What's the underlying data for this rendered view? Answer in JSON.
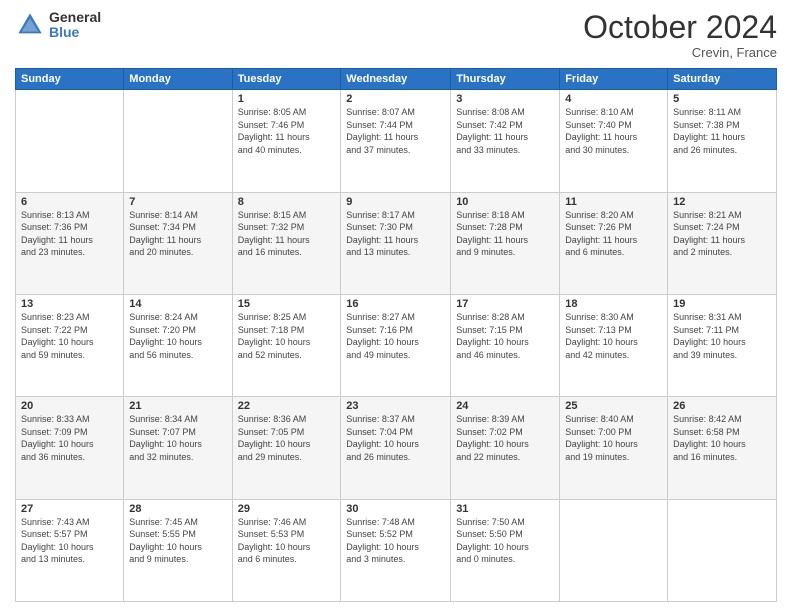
{
  "header": {
    "logo_general": "General",
    "logo_blue": "Blue",
    "month_title": "October 2024",
    "subtitle": "Crevin, France"
  },
  "weekdays": [
    "Sunday",
    "Monday",
    "Tuesday",
    "Wednesday",
    "Thursday",
    "Friday",
    "Saturday"
  ],
  "weeks": [
    [
      {
        "day": "",
        "info": ""
      },
      {
        "day": "",
        "info": ""
      },
      {
        "day": "1",
        "info": "Sunrise: 8:05 AM\nSunset: 7:46 PM\nDaylight: 11 hours\nand 40 minutes."
      },
      {
        "day": "2",
        "info": "Sunrise: 8:07 AM\nSunset: 7:44 PM\nDaylight: 11 hours\nand 37 minutes."
      },
      {
        "day": "3",
        "info": "Sunrise: 8:08 AM\nSunset: 7:42 PM\nDaylight: 11 hours\nand 33 minutes."
      },
      {
        "day": "4",
        "info": "Sunrise: 8:10 AM\nSunset: 7:40 PM\nDaylight: 11 hours\nand 30 minutes."
      },
      {
        "day": "5",
        "info": "Sunrise: 8:11 AM\nSunset: 7:38 PM\nDaylight: 11 hours\nand 26 minutes."
      }
    ],
    [
      {
        "day": "6",
        "info": "Sunrise: 8:13 AM\nSunset: 7:36 PM\nDaylight: 11 hours\nand 23 minutes."
      },
      {
        "day": "7",
        "info": "Sunrise: 8:14 AM\nSunset: 7:34 PM\nDaylight: 11 hours\nand 20 minutes."
      },
      {
        "day": "8",
        "info": "Sunrise: 8:15 AM\nSunset: 7:32 PM\nDaylight: 11 hours\nand 16 minutes."
      },
      {
        "day": "9",
        "info": "Sunrise: 8:17 AM\nSunset: 7:30 PM\nDaylight: 11 hours\nand 13 minutes."
      },
      {
        "day": "10",
        "info": "Sunrise: 8:18 AM\nSunset: 7:28 PM\nDaylight: 11 hours\nand 9 minutes."
      },
      {
        "day": "11",
        "info": "Sunrise: 8:20 AM\nSunset: 7:26 PM\nDaylight: 11 hours\nand 6 minutes."
      },
      {
        "day": "12",
        "info": "Sunrise: 8:21 AM\nSunset: 7:24 PM\nDaylight: 11 hours\nand 2 minutes."
      }
    ],
    [
      {
        "day": "13",
        "info": "Sunrise: 8:23 AM\nSunset: 7:22 PM\nDaylight: 10 hours\nand 59 minutes."
      },
      {
        "day": "14",
        "info": "Sunrise: 8:24 AM\nSunset: 7:20 PM\nDaylight: 10 hours\nand 56 minutes."
      },
      {
        "day": "15",
        "info": "Sunrise: 8:25 AM\nSunset: 7:18 PM\nDaylight: 10 hours\nand 52 minutes."
      },
      {
        "day": "16",
        "info": "Sunrise: 8:27 AM\nSunset: 7:16 PM\nDaylight: 10 hours\nand 49 minutes."
      },
      {
        "day": "17",
        "info": "Sunrise: 8:28 AM\nSunset: 7:15 PM\nDaylight: 10 hours\nand 46 minutes."
      },
      {
        "day": "18",
        "info": "Sunrise: 8:30 AM\nSunset: 7:13 PM\nDaylight: 10 hours\nand 42 minutes."
      },
      {
        "day": "19",
        "info": "Sunrise: 8:31 AM\nSunset: 7:11 PM\nDaylight: 10 hours\nand 39 minutes."
      }
    ],
    [
      {
        "day": "20",
        "info": "Sunrise: 8:33 AM\nSunset: 7:09 PM\nDaylight: 10 hours\nand 36 minutes."
      },
      {
        "day": "21",
        "info": "Sunrise: 8:34 AM\nSunset: 7:07 PM\nDaylight: 10 hours\nand 32 minutes."
      },
      {
        "day": "22",
        "info": "Sunrise: 8:36 AM\nSunset: 7:05 PM\nDaylight: 10 hours\nand 29 minutes."
      },
      {
        "day": "23",
        "info": "Sunrise: 8:37 AM\nSunset: 7:04 PM\nDaylight: 10 hours\nand 26 minutes."
      },
      {
        "day": "24",
        "info": "Sunrise: 8:39 AM\nSunset: 7:02 PM\nDaylight: 10 hours\nand 22 minutes."
      },
      {
        "day": "25",
        "info": "Sunrise: 8:40 AM\nSunset: 7:00 PM\nDaylight: 10 hours\nand 19 minutes."
      },
      {
        "day": "26",
        "info": "Sunrise: 8:42 AM\nSunset: 6:58 PM\nDaylight: 10 hours\nand 16 minutes."
      }
    ],
    [
      {
        "day": "27",
        "info": "Sunrise: 7:43 AM\nSunset: 5:57 PM\nDaylight: 10 hours\nand 13 minutes."
      },
      {
        "day": "28",
        "info": "Sunrise: 7:45 AM\nSunset: 5:55 PM\nDaylight: 10 hours\nand 9 minutes."
      },
      {
        "day": "29",
        "info": "Sunrise: 7:46 AM\nSunset: 5:53 PM\nDaylight: 10 hours\nand 6 minutes."
      },
      {
        "day": "30",
        "info": "Sunrise: 7:48 AM\nSunset: 5:52 PM\nDaylight: 10 hours\nand 3 minutes."
      },
      {
        "day": "31",
        "info": "Sunrise: 7:50 AM\nSunset: 5:50 PM\nDaylight: 10 hours\nand 0 minutes."
      },
      {
        "day": "",
        "info": ""
      },
      {
        "day": "",
        "info": ""
      }
    ]
  ]
}
